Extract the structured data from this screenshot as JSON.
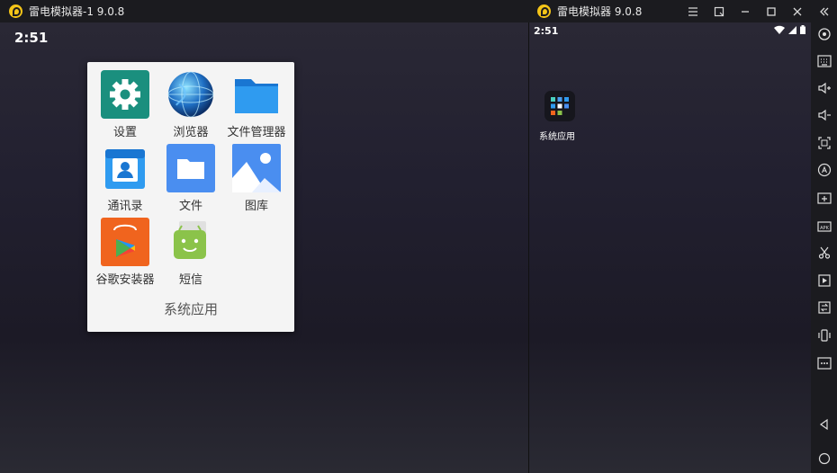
{
  "left_window": {
    "title": "雷电模拟器-1 9.0.8",
    "time": "2:51"
  },
  "right_window": {
    "title": "雷电模拟器 9.0.8",
    "time": "2:51",
    "desktop_app_label": "系统应用"
  },
  "folder": {
    "title": "系统应用",
    "apps": [
      {
        "label": "设置",
        "icon": "settings-icon"
      },
      {
        "label": "浏览器",
        "icon": "browser-icon"
      },
      {
        "label": "文件管理器",
        "icon": "file-manager-icon"
      },
      {
        "label": "通讯录",
        "icon": "contacts-icon"
      },
      {
        "label": "文件",
        "icon": "files-icon"
      },
      {
        "label": "图库",
        "icon": "gallery-icon"
      },
      {
        "label": "谷歌安装器",
        "icon": "google-installer-icon"
      },
      {
        "label": "短信",
        "icon": "messages-icon"
      }
    ]
  },
  "colors": {
    "titlebar": "#1b1b1f",
    "folder_bg": "#f4f4f4",
    "logo": "#f5c518"
  }
}
